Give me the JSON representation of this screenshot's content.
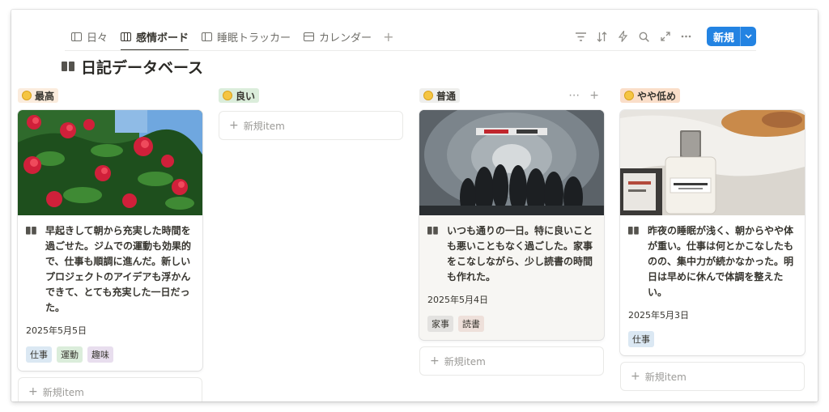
{
  "tabs": [
    {
      "label": "日々",
      "icon": "table-icon"
    },
    {
      "label": "感情ボード",
      "icon": "board-icon"
    },
    {
      "label": "睡眠トラッカー",
      "icon": "table-icon"
    },
    {
      "label": "カレンダー",
      "icon": "calendar-icon"
    }
  ],
  "tab_add": "+",
  "toolbar": {
    "new_label": "新規",
    "new_caret": "⌄"
  },
  "database_title": "日記データベース",
  "columns": [
    {
      "label": "最高",
      "color": "#fbecdd",
      "cards": [
        {
          "title": "早起きして朝から充実した時間を過ごせた。ジムでの運動も効果的で、仕事も順調に進んだ。新しいプロジェクトのアイデアも浮かんできて、とても充実した一日だった。",
          "date": "2025年5月5日",
          "tags": [
            {
              "label": "仕事",
              "color": "#dbe8f3"
            },
            {
              "label": "運動",
              "color": "#dbeddb"
            },
            {
              "label": "趣味",
              "color": "#e8deee"
            }
          ]
        }
      ],
      "add_label": "新規item"
    },
    {
      "label": "良い",
      "color": "#dbeddb",
      "cards": [],
      "add_label": "新規item"
    },
    {
      "label": "普通",
      "color": "#eeeeec",
      "cards": [
        {
          "title": "いつも通りの一日。特に良いことも悪いこともなく過ごした。家事をこなしながら、少し読書の時間も作れた。",
          "date": "2025年5月4日",
          "tags": [
            {
              "label": "家事",
              "color": "#e3e2e0"
            },
            {
              "label": "読書",
              "color": "#eee0da"
            }
          ]
        }
      ],
      "add_label": "新規item"
    },
    {
      "label": "やや低め",
      "color": "#fadec9",
      "cards": [
        {
          "title": "昨夜の睡眠が浅く、朝からやや体が重い。仕事は何とかこなしたものの、集中力が続かなかった。明日は早めに休んで体調を整えたい。",
          "date": "2025年5月3日",
          "tags": [
            {
              "label": "仕事",
              "color": "#dbe8f3"
            }
          ]
        }
      ],
      "add_label": "新規item"
    }
  ],
  "accent_color": "#2383e2"
}
